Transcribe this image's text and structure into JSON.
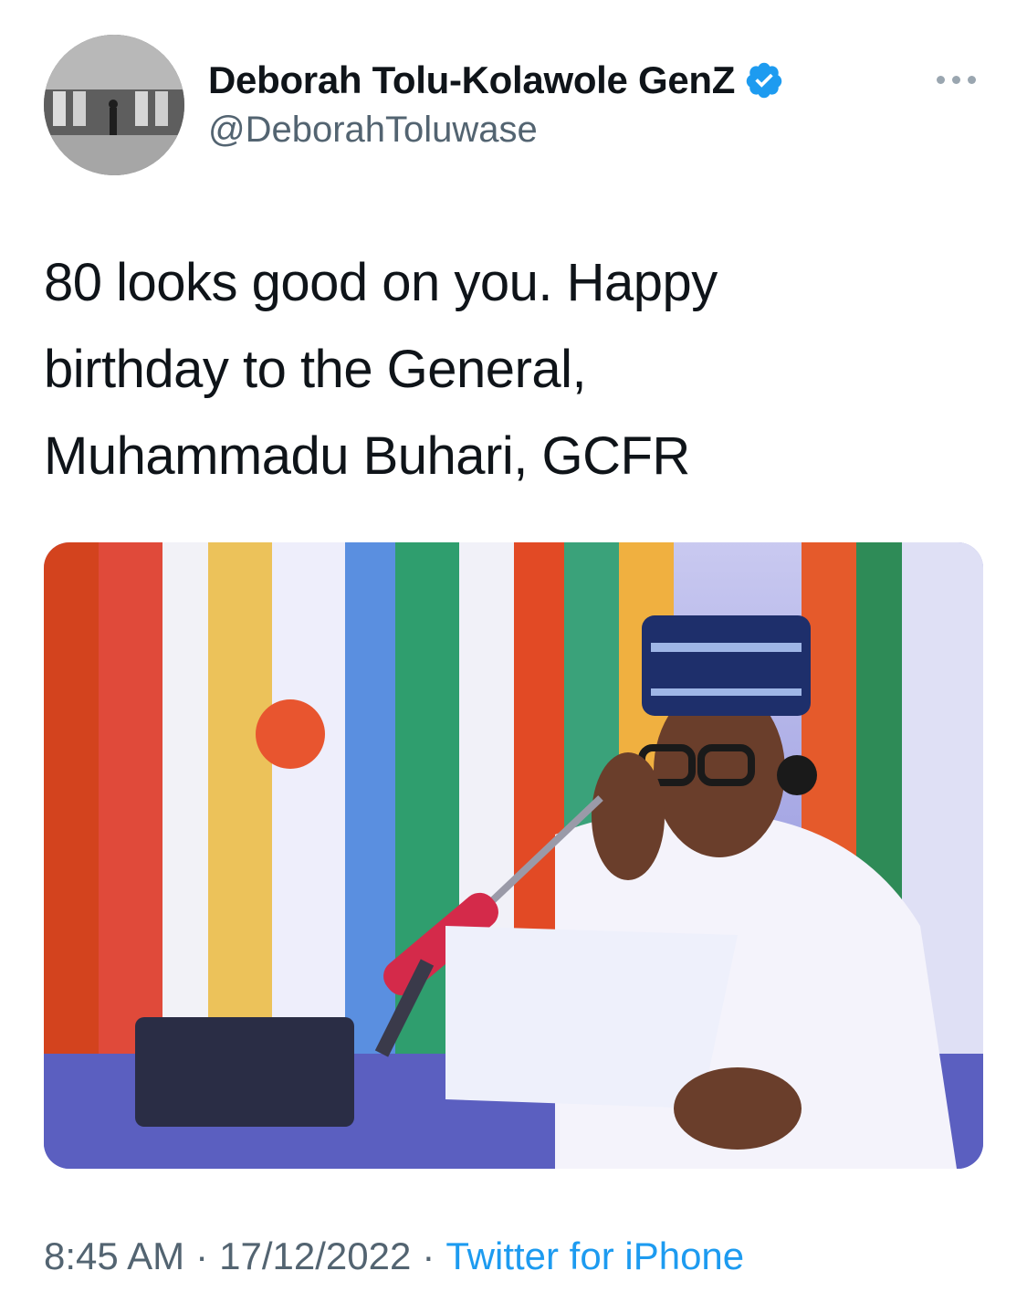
{
  "author": {
    "display_name": "Deborah Tolu-Kolawole GenZ",
    "handle": "@DeborahToluwase",
    "verified": true,
    "avatar_icon": "profile-photo-gallery-hall"
  },
  "tweet": {
    "text": "80 looks good on you. Happy\nbirthday to the General,\nMuhammadu Buhari, GCFR",
    "media_description_icon": "photo-man-in-cap-reading-at-microphone"
  },
  "meta": {
    "time": "8:45 AM",
    "date": "17/12/2022",
    "separator": "·",
    "source": "Twitter for iPhone"
  },
  "colors": {
    "link": "#1d9bf0",
    "secondary": "#536471",
    "verified": "#1d9bf0"
  }
}
